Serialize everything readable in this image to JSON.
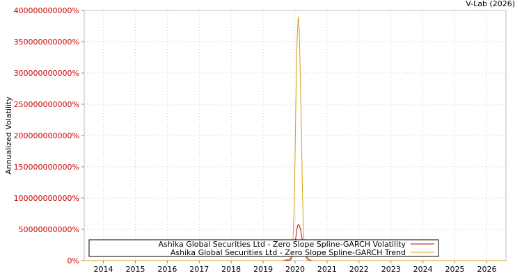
{
  "credit": "V-Lab (2026)",
  "chart_data": {
    "type": "line",
    "ylabel": "Annualized Volatility",
    "xlabel": "",
    "title": "",
    "xlim": [
      2013.4,
      2026.6
    ],
    "ylim": [
      0,
      400000000000
    ],
    "y_ticks": [
      0,
      50000000000,
      100000000000,
      150000000000,
      200000000000,
      250000000000,
      300000000000,
      350000000000,
      400000000000
    ],
    "y_tick_labels": [
      "0%",
      "50000000000%",
      "100000000000%",
      "150000000000%",
      "200000000000%",
      "250000000000%",
      "300000000000%",
      "350000000000%",
      "400000000000%"
    ],
    "x_ticks": [
      2014,
      2015,
      2016,
      2017,
      2018,
      2019,
      2020,
      2021,
      2022,
      2023,
      2024,
      2025,
      2026
    ],
    "x_tick_labels": [
      "2014",
      "2015",
      "2016",
      "2017",
      "2018",
      "2019",
      "2020",
      "2021",
      "2022",
      "2023",
      "2024",
      "2025",
      "2026"
    ],
    "grid": true,
    "legend_position": "bottom-left",
    "series": [
      {
        "name": "Ashika Global Securities Ltd - Zero Slope Spline-GARCH Volatility",
        "color": "#cc0000",
        "x": [
          2013.4,
          2019.6,
          2019.85,
          2019.95,
          2020.0,
          2020.05,
          2020.08,
          2020.12,
          2020.17,
          2020.22,
          2020.27,
          2020.35,
          2020.45,
          2020.55,
          2026.6
        ],
        "y": [
          0,
          0,
          1000000000,
          10000000000,
          28000000000,
          48000000000,
          56000000000,
          58000000000,
          50000000000,
          35000000000,
          18000000000,
          6000000000,
          1000000000,
          0,
          0
        ]
      },
      {
        "name": "Ashika Global Securities Ltd - Zero Slope Spline-GARCH Trend",
        "color": "#d4a017",
        "x": [
          2013.4,
          2019.6,
          2019.85,
          2019.93,
          2019.97,
          2020.0,
          2020.03,
          2020.06,
          2020.09,
          2020.1,
          2020.13,
          2020.16,
          2020.2,
          2020.23,
          2020.26,
          2020.3,
          2020.36,
          2020.45,
          2026.6
        ],
        "y": [
          0,
          0,
          3000000000,
          30000000000,
          80000000000,
          170000000000,
          270000000000,
          350000000000,
          385000000000,
          390000000000,
          370000000000,
          300000000000,
          200000000000,
          110000000000,
          50000000000,
          15000000000,
          2000000000,
          0,
          0
        ]
      }
    ]
  }
}
